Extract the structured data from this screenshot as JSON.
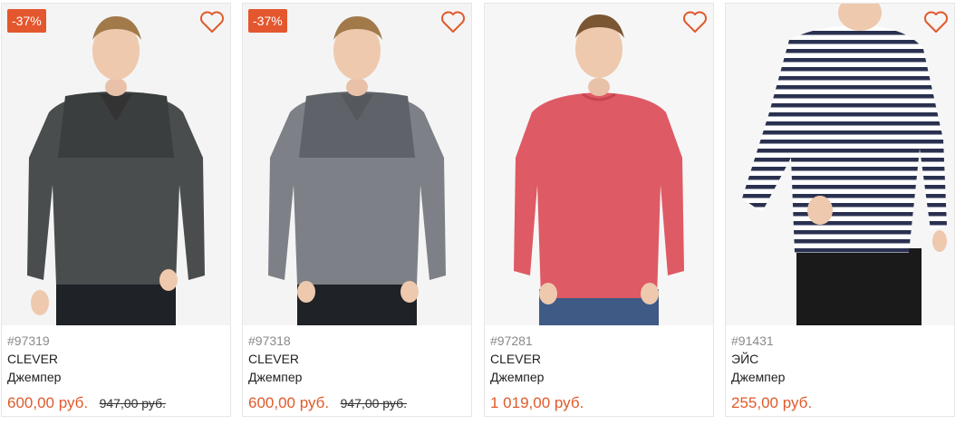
{
  "products": [
    {
      "badge": "-37%",
      "sku": "#97319",
      "brand": "CLEVER",
      "type": "Джемпер",
      "price": "600,00 руб.",
      "old_price": "947,00 руб.",
      "colors": {
        "sweater": "#4a4d4d",
        "yoke": "#3b3e3f",
        "pants": "#1f2226"
      }
    },
    {
      "badge": "-37%",
      "sku": "#97318",
      "brand": "CLEVER",
      "type": "Джемпер",
      "price": "600,00 руб.",
      "old_price": "947,00 руб.",
      "colors": {
        "sweater": "#7d8086",
        "yoke": "#5f6268",
        "pants": "#1f2226"
      }
    },
    {
      "sku": "#97281",
      "brand": "CLEVER",
      "type": "Джемпер",
      "price": "1 019,00 руб.",
      "colors": {
        "sweater": "#de5a64",
        "yoke": "#d8525d",
        "pants": "#3f5a85"
      }
    },
    {
      "sku": "#91431",
      "brand": "ЭЙС",
      "type": "Джемпер",
      "price": "255,00 руб.",
      "colors": {
        "stripe_dark": "#2a3150",
        "stripe_light": "#ffffff",
        "pants": "#1a1a1a"
      }
    }
  ],
  "accent": "#e05a2b",
  "badge_color": "#e4572e",
  "icons": {
    "favorite": "heart-icon"
  }
}
